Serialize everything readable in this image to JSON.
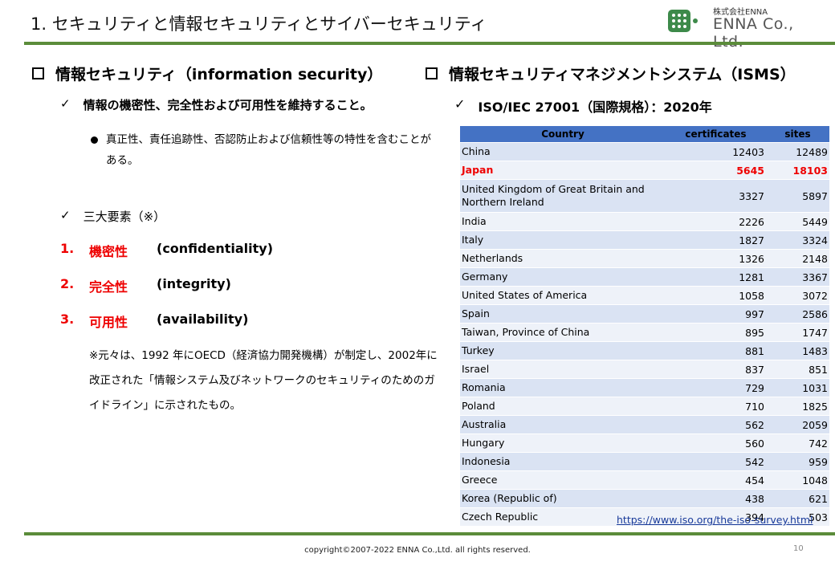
{
  "header": {
    "title": "1. セキュリティと情報セキュリティとサイバーセキュリティ",
    "logo_company_jp": "株式会社ENNA",
    "logo_company_en": "ENNA Co., Ltd."
  },
  "left": {
    "heading": "情報セキュリティ（information security）",
    "definition": "情報の機密性、完全性および可用性を維持すること。",
    "bullet": "真正性、責任追跡性、否認防止および信頼性等の特性を含むことがある。",
    "elements_title": "三大要素（※）",
    "elements": [
      {
        "num": "1.",
        "jp": "機密性",
        "en": "(confidentiality)"
      },
      {
        "num": "2.",
        "jp": "完全性",
        "en": "(integrity)"
      },
      {
        "num": "3.",
        "jp": "可用性",
        "en": "(availability)"
      }
    ],
    "note": "※元々は、1992 年にOECD（経済協力開発機構）が制定し、2002年に改正された「情報システム及びネットワークのセキュリティのためのガイドライン」に示されたもの。"
  },
  "right": {
    "heading": "情報セキュリティマネジメントシステム（ISMS）",
    "subheading": "ISO/IEC 27001（国際規格）：2020年",
    "table": {
      "headers": [
        "Country",
        "certificates",
        "sites"
      ],
      "rows": [
        [
          "China",
          "12403",
          "12489"
        ],
        [
          "Japan",
          "5645",
          "18103"
        ],
        [
          "United Kingdom of Great Britain and Northern Ireland",
          "3327",
          "5897"
        ],
        [
          "India",
          "2226",
          "5449"
        ],
        [
          "Italy",
          "1827",
          "3324"
        ],
        [
          "Netherlands",
          "1326",
          "2148"
        ],
        [
          "Germany",
          "1281",
          "3367"
        ],
        [
          "United States of America",
          "1058",
          "3072"
        ],
        [
          "Spain",
          "997",
          "2586"
        ],
        [
          "Taiwan, Province of China",
          "895",
          "1747"
        ],
        [
          "Turkey",
          "881",
          "1483"
        ],
        [
          "Israel",
          "837",
          "851"
        ],
        [
          "Romania",
          "729",
          "1031"
        ],
        [
          "Poland",
          "710",
          "1825"
        ],
        [
          "Australia",
          "562",
          "2059"
        ],
        [
          "Hungary",
          "560",
          "742"
        ],
        [
          "Indonesia",
          "542",
          "959"
        ],
        [
          "Greece",
          "454",
          "1048"
        ],
        [
          "Korea (Republic of)",
          "438",
          "621"
        ],
        [
          "Czech Republic",
          "394",
          "503"
        ]
      ],
      "highlight_row": "Japan"
    },
    "source_link": "https://www.iso.org/the-iso-survey.html"
  },
  "footer": {
    "copyright": "copyright©2007-2022 ENNA Co.,Ltd. all rights reserved.",
    "page_number": "10"
  },
  "colors": {
    "accent_green": "#5b8c3a",
    "table_header": "#4472c4",
    "highlight_red": "#e00000"
  }
}
